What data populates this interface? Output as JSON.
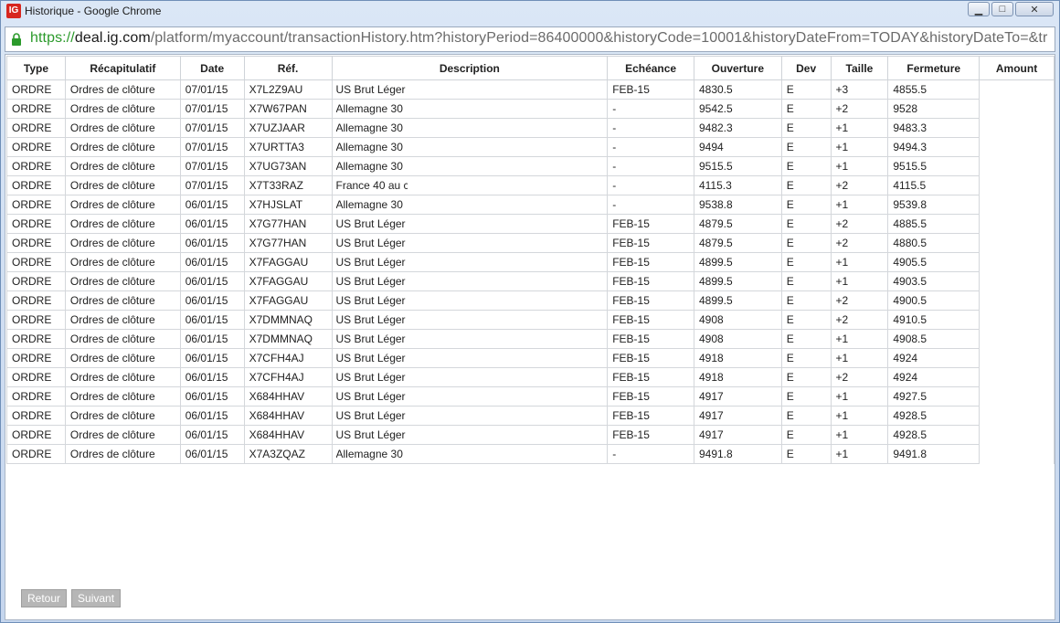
{
  "window": {
    "title": "Historique - Google Chrome",
    "app_icon_text": "IG",
    "controls": {
      "minimize": "▁",
      "maximize": "□",
      "close": "✕"
    }
  },
  "addressbar": {
    "scheme": "https://",
    "host": "deal.ig.com",
    "path": "/platform/myaccount/transactionHistory.htm?historyPeriod=86400000&historyCode=10001&historyDateFrom=TODAY&historyDateTo=&tr"
  },
  "table": {
    "headers": [
      "Type",
      "Récapitulatif",
      "Date",
      "Réf.",
      "Description",
      "Echéance",
      "Ouverture",
      "Dev",
      "Taille",
      "Fermeture",
      "Amount"
    ],
    "rows": [
      [
        "ORDRE",
        "Ordres de clôture",
        "07/01/15",
        "X7L2Z9AU",
        "US Brut Léger",
        "FEB-15",
        "4830.5",
        "E",
        "+3",
        "4855.5"
      ],
      [
        "ORDRE",
        "Ordres de clôture",
        "07/01/15",
        "X7W67PAN",
        "Allemagne 30",
        "-",
        "9542.5",
        "E",
        "+2",
        "9528"
      ],
      [
        "ORDRE",
        "Ordres de clôture",
        "07/01/15",
        "X7UZJAAR",
        "Allemagne 30",
        "-",
        "9482.3",
        "E",
        "+1",
        "9483.3"
      ],
      [
        "ORDRE",
        "Ordres de clôture",
        "07/01/15",
        "X7URTTA3",
        "Allemagne 30",
        "-",
        "9494",
        "E",
        "+1",
        "9494.3"
      ],
      [
        "ORDRE",
        "Ordres de clôture",
        "07/01/15",
        "X7UG73AN",
        "Allemagne 30",
        "-",
        "9515.5",
        "E",
        "+1",
        "9515.5"
      ],
      [
        "ORDRE",
        "Ordres de clôture",
        "07/01/15",
        "X7T33RAZ",
        "France 40 au c",
        "-",
        "4115.3",
        "E",
        "+2",
        "4115.5"
      ],
      [
        "ORDRE",
        "Ordres de clôture",
        "06/01/15",
        "X7HJSLAT",
        "Allemagne 30",
        "-",
        "9538.8",
        "E",
        "+1",
        "9539.8"
      ],
      [
        "ORDRE",
        "Ordres de clôture",
        "06/01/15",
        "X7G77HAN",
        "US Brut Léger",
        "FEB-15",
        "4879.5",
        "E",
        "+2",
        "4885.5"
      ],
      [
        "ORDRE",
        "Ordres de clôture",
        "06/01/15",
        "X7G77HAN",
        "US Brut Léger",
        "FEB-15",
        "4879.5",
        "E",
        "+2",
        "4880.5"
      ],
      [
        "ORDRE",
        "Ordres de clôture",
        "06/01/15",
        "X7FAGGAU",
        "US Brut Léger",
        "FEB-15",
        "4899.5",
        "E",
        "+1",
        "4905.5"
      ],
      [
        "ORDRE",
        "Ordres de clôture",
        "06/01/15",
        "X7FAGGAU",
        "US Brut Léger",
        "FEB-15",
        "4899.5",
        "E",
        "+1",
        "4903.5"
      ],
      [
        "ORDRE",
        "Ordres de clôture",
        "06/01/15",
        "X7FAGGAU",
        "US Brut Léger",
        "FEB-15",
        "4899.5",
        "E",
        "+2",
        "4900.5"
      ],
      [
        "ORDRE",
        "Ordres de clôture",
        "06/01/15",
        "X7DMMNAQ",
        "US Brut Léger",
        "FEB-15",
        "4908",
        "E",
        "+2",
        "4910.5"
      ],
      [
        "ORDRE",
        "Ordres de clôture",
        "06/01/15",
        "X7DMMNAQ",
        "US Brut Léger",
        "FEB-15",
        "4908",
        "E",
        "+1",
        "4908.5"
      ],
      [
        "ORDRE",
        "Ordres de clôture",
        "06/01/15",
        "X7CFH4AJ",
        "US Brut Léger",
        "FEB-15",
        "4918",
        "E",
        "+1",
        "4924"
      ],
      [
        "ORDRE",
        "Ordres de clôture",
        "06/01/15",
        "X7CFH4AJ",
        "US Brut Léger",
        "FEB-15",
        "4918",
        "E",
        "+2",
        "4924"
      ],
      [
        "ORDRE",
        "Ordres de clôture",
        "06/01/15",
        "X684HHAV",
        "US Brut Léger",
        "FEB-15",
        "4917",
        "E",
        "+1",
        "4927.5"
      ],
      [
        "ORDRE",
        "Ordres de clôture",
        "06/01/15",
        "X684HHAV",
        "US Brut Léger",
        "FEB-15",
        "4917",
        "E",
        "+1",
        "4928.5"
      ],
      [
        "ORDRE",
        "Ordres de clôture",
        "06/01/15",
        "X684HHAV",
        "US Brut Léger",
        "FEB-15",
        "4917",
        "E",
        "+1",
        "4928.5"
      ],
      [
        "ORDRE",
        "Ordres de clôture",
        "06/01/15",
        "X7A3ZQAZ",
        "Allemagne 30",
        "-",
        "9491.8",
        "E",
        "+1",
        "9491.8"
      ]
    ]
  },
  "pager": {
    "back": "Retour",
    "next": "Suivant"
  },
  "colors": {
    "url_scheme": "#2b9a2b",
    "button_gray": "#b6b6b6",
    "app_icon_red": "#d7261e"
  }
}
